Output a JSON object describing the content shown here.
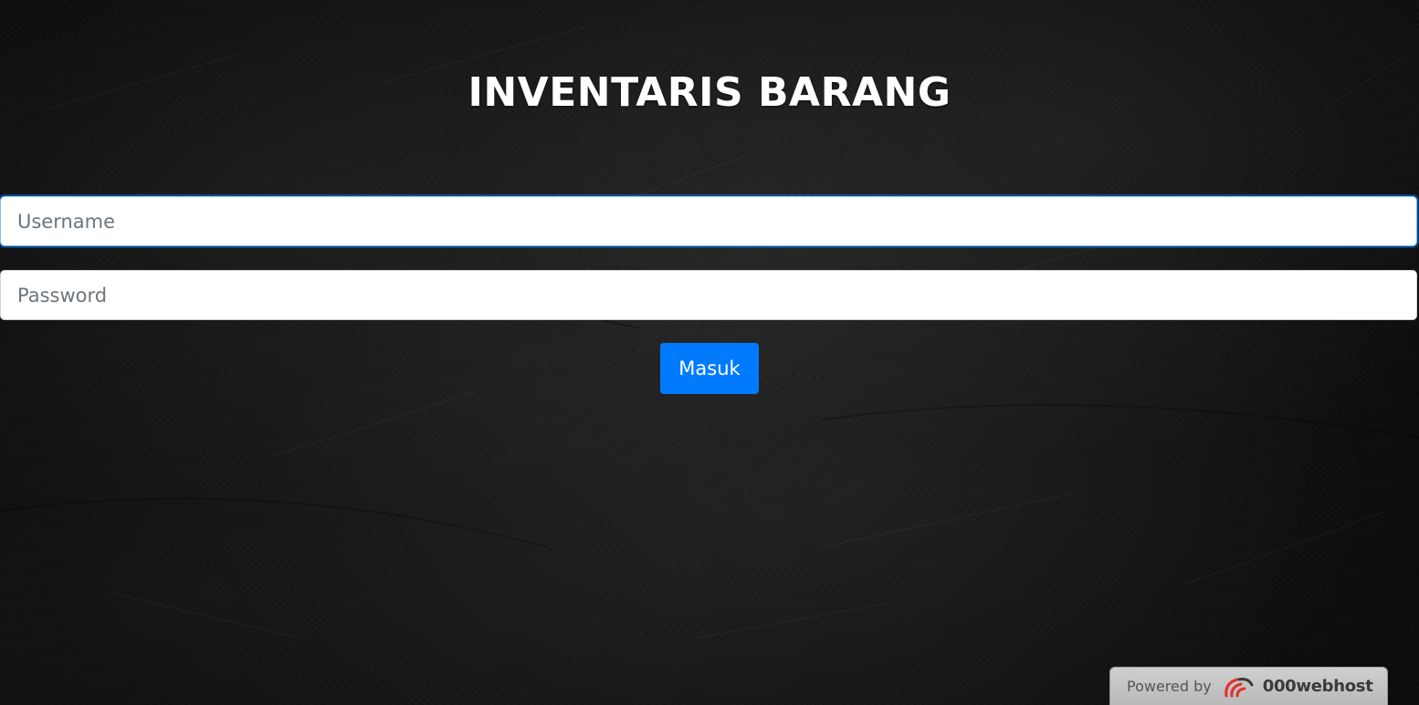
{
  "page": {
    "title": "INVENTARIS BARANG"
  },
  "form": {
    "username": {
      "value": "",
      "placeholder": "Username"
    },
    "password": {
      "value": "",
      "placeholder": "Password"
    },
    "submit_label": "Masuk"
  },
  "footer": {
    "powered_by": "Powered by",
    "brand": "000webhost",
    "logo_icon": "000webhost-logo-icon"
  },
  "colors": {
    "primary_button": "#007bff",
    "background": "#141414",
    "title_text": "#ffffff",
    "logo_accent": "#e1302a"
  }
}
